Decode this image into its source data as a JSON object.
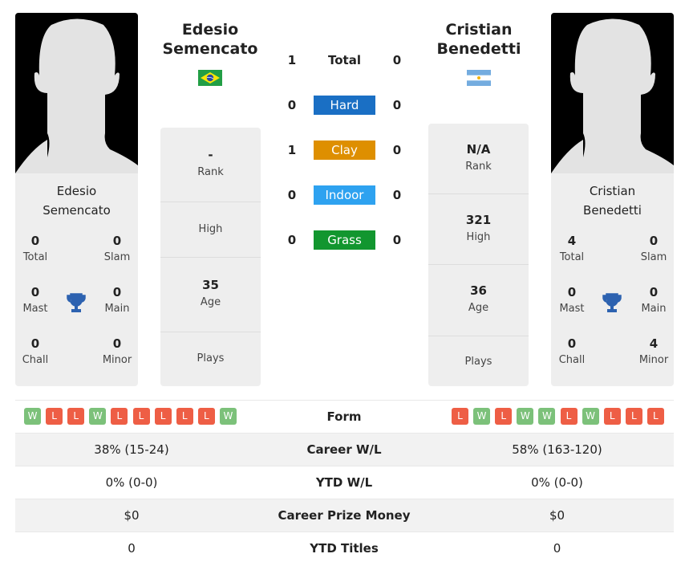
{
  "colors": {
    "win": "#7cc17a",
    "loss": "#ee5e45",
    "hard": "#1a6fc4",
    "clay": "#de8f00",
    "indoor": "#2ea2f0",
    "grass": "#12962f"
  },
  "player1": {
    "name": "Edesio Semencato",
    "name_line1": "Edesio",
    "name_line2": "Semencato",
    "flag": "brazil-flag-icon",
    "stats": {
      "total": "0",
      "slam": "0",
      "mast": "0",
      "main": "0",
      "chall": "0",
      "minor": "0"
    },
    "rank": "-",
    "high": "",
    "age": "35",
    "plays": ""
  },
  "player2": {
    "name": "Cristian Benedetti",
    "name_line1": "Cristian",
    "name_line2": "Benedetti",
    "flag": "argentina-flag-icon",
    "stats": {
      "total": "4",
      "slam": "0",
      "mast": "0",
      "main": "0",
      "chall": "0",
      "minor": "4"
    },
    "rank": "N/A",
    "high": "321",
    "age": "36",
    "plays": ""
  },
  "labels": {
    "total": "Total",
    "slam": "Slam",
    "mast": "Mast",
    "main": "Main",
    "chall": "Chall",
    "minor": "Minor",
    "rank": "Rank",
    "high": "High",
    "age": "Age",
    "plays": "Plays"
  },
  "h2h": [
    {
      "label": "Total",
      "p1": "1",
      "p2": "0"
    },
    {
      "label": "Hard",
      "p1": "0",
      "p2": "0"
    },
    {
      "label": "Clay",
      "p1": "1",
      "p2": "0"
    },
    {
      "label": "Indoor",
      "p1": "0",
      "p2": "0"
    },
    {
      "label": "Grass",
      "p1": "0",
      "p2": "0"
    }
  ],
  "form": {
    "label": "Form",
    "p1": [
      "W",
      "L",
      "L",
      "W",
      "L",
      "L",
      "L",
      "L",
      "L",
      "W"
    ],
    "p2": [
      "L",
      "W",
      "L",
      "W",
      "W",
      "L",
      "W",
      "L",
      "L",
      "L"
    ]
  },
  "rows": [
    {
      "label": "Career W/L",
      "p1": "38% (15-24)",
      "p2": "58% (163-120)"
    },
    {
      "label": "YTD W/L",
      "p1": "0% (0-0)",
      "p2": "0% (0-0)"
    },
    {
      "label": "Career Prize Money",
      "p1": "$0",
      "p2": "$0"
    },
    {
      "label": "YTD Titles",
      "p1": "0",
      "p2": "0"
    }
  ]
}
